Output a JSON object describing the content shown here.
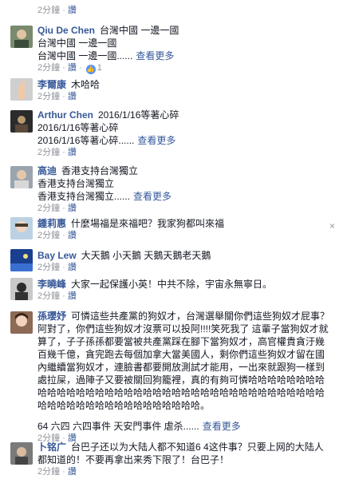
{
  "top_meta": {
    "time": "2分鐘",
    "sep": "·",
    "reply": "讚"
  },
  "comments": [
    {
      "name": "Qiu De Chen",
      "text": "台灣中國 一邊一國",
      "extra_lines": [
        "台灣中國 一邊一國",
        "台灣中國 一邊一國......"
      ],
      "more": "查看更多",
      "time": "2分鐘",
      "reply": "讚",
      "likes": "1"
    },
    {
      "name": "李爾康",
      "text": "木哈哈",
      "time": "2分鐘",
      "reply": "讚"
    },
    {
      "name": "Arthur Chen",
      "text": "2016/1/16等著心碎",
      "extra_lines": [
        "2016/1/16等著心碎",
        "2016/1/16等著心碎......"
      ],
      "more": "查看更多",
      "time": "2分鐘",
      "reply": "讚"
    },
    {
      "name": "高迪",
      "text": "香港支持台灣獨立",
      "extra_lines": [
        "香港支持台灣獨立",
        "香港支持台灣獨立......"
      ],
      "more": "查看更多",
      "time": "2分鐘",
      "reply": "讚"
    },
    {
      "name": "鍾莉惠",
      "text": "什麼場福是來福吧？我家狗都叫來福",
      "time": "2分鐘",
      "reply": "讚"
    },
    {
      "name": "Bay Lew",
      "text": "大天鵝 小天鵝 天鵝天鵝老天鵝",
      "time": "2分鐘",
      "reply": "讚"
    },
    {
      "name": "李曉峰",
      "text": "大家一起保護小英！中共不除，宇宙永無寧日。",
      "time": "2分鐘",
      "reply": "讚"
    },
    {
      "name": "孫瓔妤",
      "text": "可憐這些共產黨的狗奴才，台灣選舉關你們這些狗奴才屁事？阿對了，你們這些狗奴才沒票可以投阿!!!!笑死我了 這輩子當狗奴才就算了，子子孫孫都要當被共產黨踩在腳下當狗奴才，高官權貴貪汙幾百幾千億，貪完跑去每個加拿大當美國人，剩你們這些狗奴才留在國內繼續當狗奴才，連臉書都要開放測試才能用，一出來就跟狗一樣到處拉屎，過陣子又要被關回狗籠裡，真的有夠可憐哈哈哈哈哈哈哈哈哈哈哈哈哈哈哈哈哈哈哈哈哈哈哈哈哈哈哈哈哈哈哈哈哈哈哈哈哈哈哈哈哈哈哈哈哈哈哈哈哈哈哈哈哈哈哈。",
      "extra_lines": [
        "64 六四 六四事件 天安門事件 虐杀......"
      ],
      "more": "查看更多",
      "time": "2分鐘",
      "reply": "讚"
    },
    {
      "name": "卜铭广",
      "text": "台巴子还以为大陆人都不知道6 4这件事？只要上网的大陆人都知道的！不要再拿出来秀下限了！台巴子！",
      "time": "2分鐘",
      "reply": "讚"
    }
  ],
  "close_glyph": "×",
  "colors": {
    "link": "#365899",
    "meta": "#90949c",
    "text": "#141823",
    "like": "#5890ff"
  }
}
